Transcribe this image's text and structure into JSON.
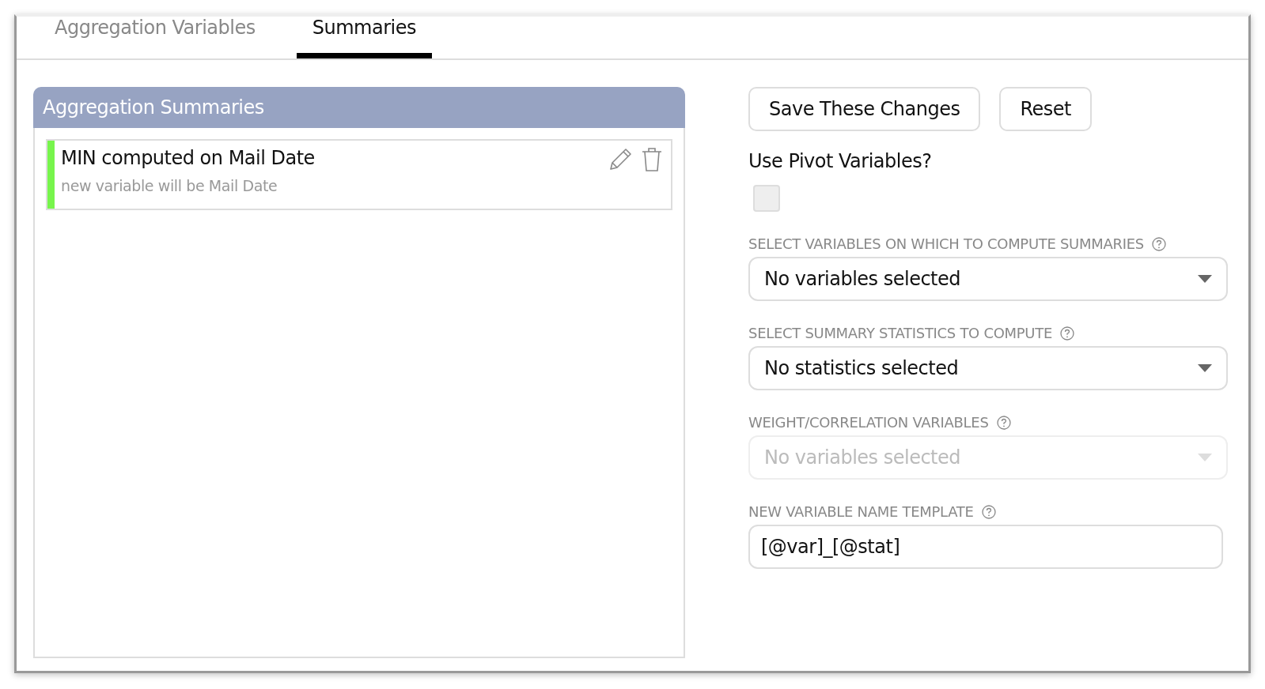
{
  "tabs": [
    {
      "label": "Aggregation Variables",
      "selected": false
    },
    {
      "label": "Summaries",
      "selected": true
    }
  ],
  "summaries_panel": {
    "title": "Aggregation Summaries",
    "items": [
      {
        "title": "MIN computed on Mail Date",
        "subtitle": "new variable will be Mail Date",
        "color": "#77f54c"
      }
    ]
  },
  "buttons": [
    "Save These Changes",
    "Reset"
  ],
  "pivot": {
    "label": "Use Pivot Variables?",
    "checked": false
  },
  "fields": [
    {
      "kind": "dropdown",
      "label": "SELECT VARIABLES ON WHICH TO COMPUTE SUMMARIES",
      "value": "No variables selected",
      "disabled": false
    },
    {
      "kind": "dropdown",
      "label": "SELECT SUMMARY STATISTICS TO COMPUTE",
      "value": "No statistics selected",
      "disabled": false
    },
    {
      "kind": "dropdown",
      "label": "WEIGHT/CORRELATION VARIABLES",
      "value": "No variables selected",
      "disabled": true
    },
    {
      "kind": "text",
      "label": "NEW VARIABLE NAME TEMPLATE",
      "value": "[@var]_[@stat]",
      "disabled": false
    }
  ]
}
